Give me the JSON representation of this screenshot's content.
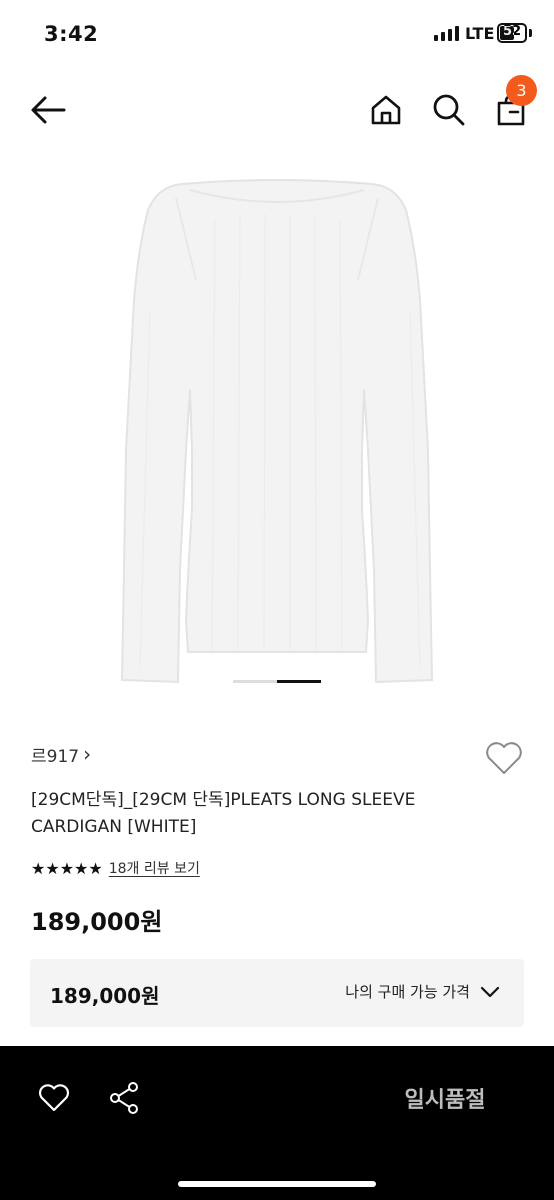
{
  "status_bar": {
    "time": "3:42",
    "network": "LTE",
    "battery": "52",
    "battery_level": 0.52
  },
  "nav": {
    "icons": [
      "back-arrow-icon",
      "home-icon",
      "search-icon",
      "shopping-bag-icon"
    ],
    "cart_count": "3",
    "badge_color": "#f25b1b"
  },
  "gallery": {
    "current_index": 2,
    "total": 2
  },
  "product": {
    "brand": "르917",
    "brand_chevron": "›",
    "title": "[29CM단독]_[29CM 단독]PLEATS LONG SLEEVE CARDIGAN [WHITE]",
    "rating_stars": "★★★★★",
    "review_link": "18개 리뷰 보기",
    "price": "189,000원"
  },
  "price_box": {
    "price": "189,000원",
    "label": "나의 구매 가능 가격"
  },
  "bottom_bar": {
    "soldout_label": "일시품절",
    "icons": [
      "heart-icon",
      "share-icon"
    ]
  }
}
